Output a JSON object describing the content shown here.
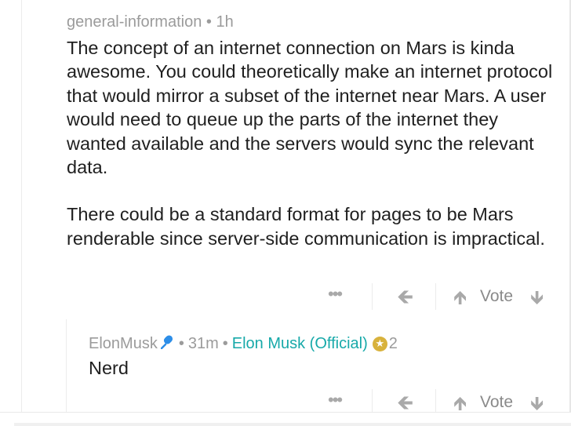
{
  "post": {
    "channel": "general-information",
    "separator": "•",
    "time": "1h",
    "paragraphs": [
      "The concept of an internet connection on Mars is kinda awesome. You could theoretically make an internet protocol that would mirror a subset of the internet near Mars. A user would need to queue up the parts of the internet they wanted available and the servers would sync the relevant data.",
      "There could be a standard format for pages to be Mars renderable since server-side communication is impractical."
    ],
    "actions": {
      "more": "•••",
      "vote_label": "Vote"
    }
  },
  "reply": {
    "author": "ElonMusk",
    "separator": "•",
    "time": "31m",
    "flair": "Elon Musk (Official)",
    "badge_count": "2",
    "text": "Nerd",
    "actions": {
      "more": "•••",
      "vote_label": "Vote"
    }
  },
  "colors": {
    "meta": "#9b9b9b",
    "body": "#1f1f1f",
    "flair": "#17a9a9",
    "mic": "#2d8ee8",
    "badge": "#d8b23c"
  }
}
